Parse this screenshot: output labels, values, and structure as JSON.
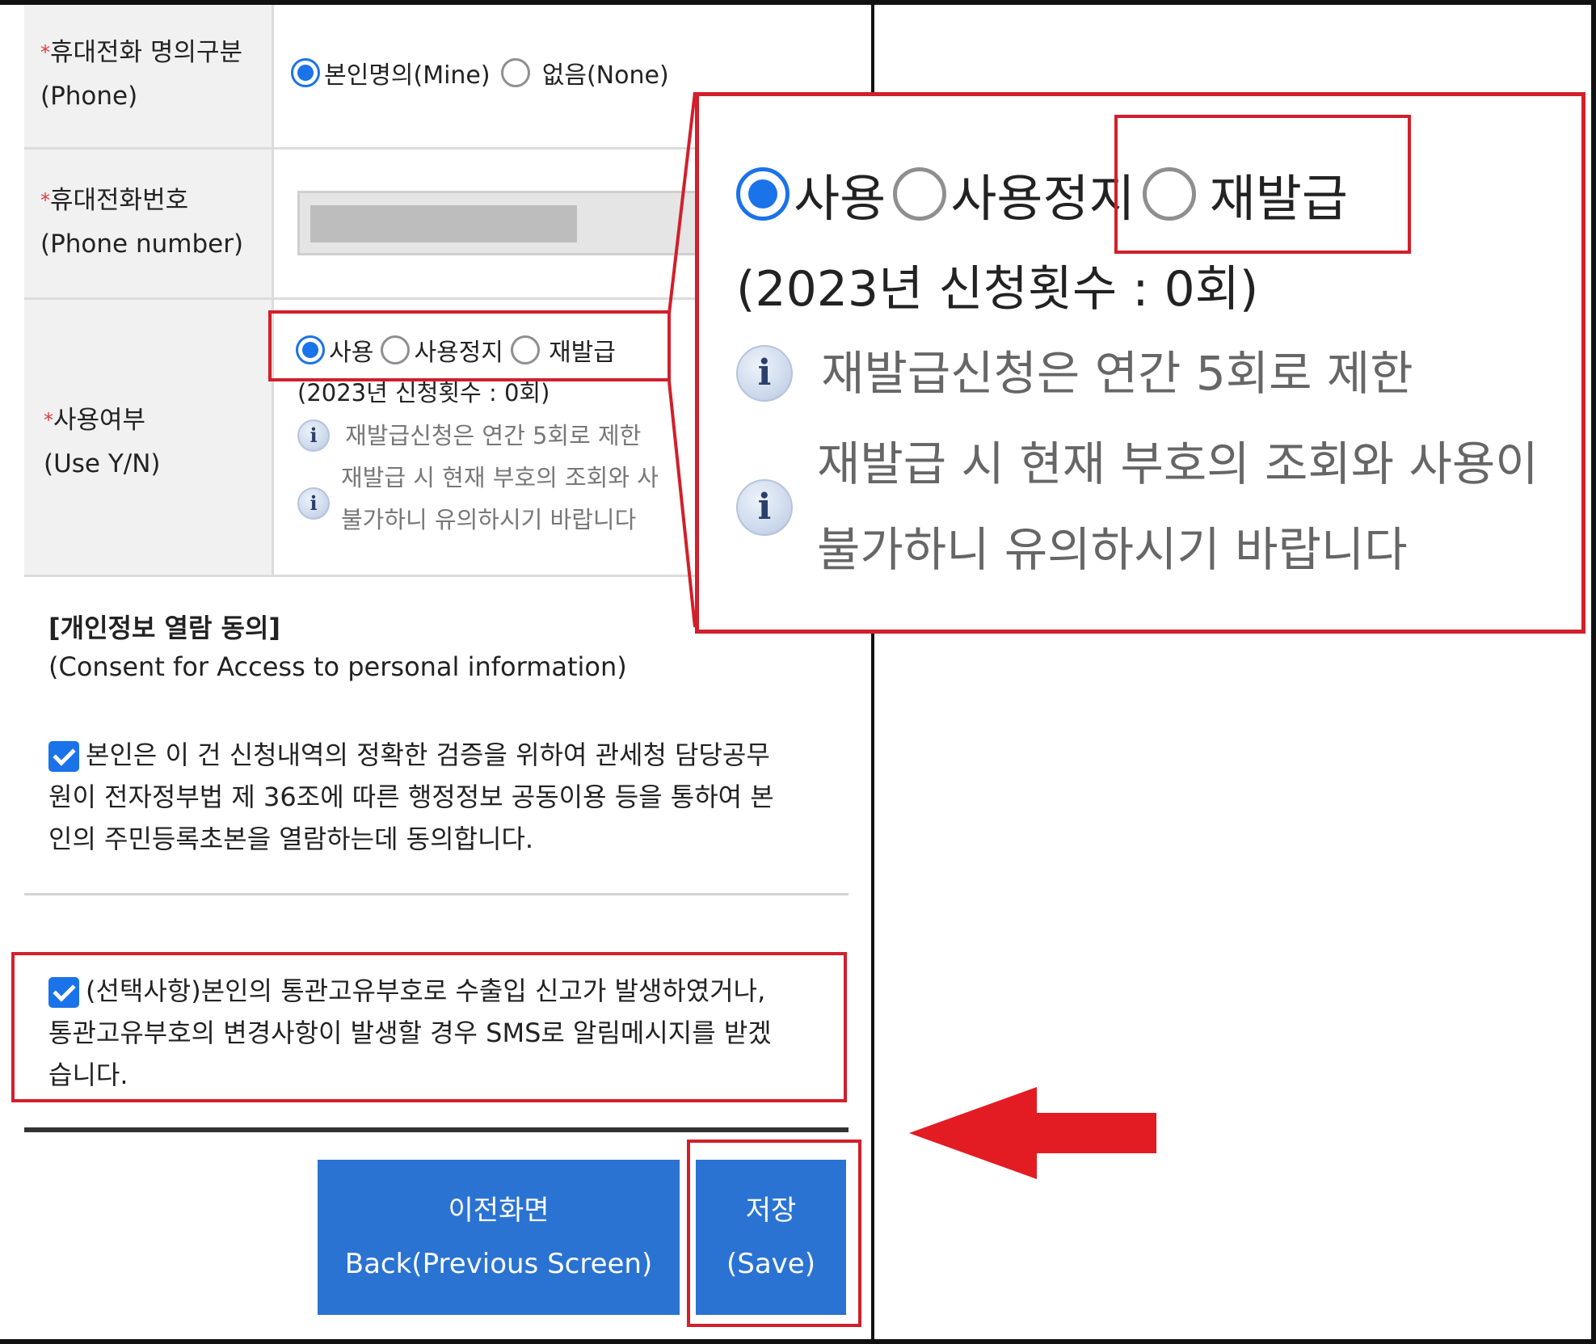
{
  "phone_owner": {
    "label_ko": "휴대전화 명의구분",
    "label_en": "(Phone)",
    "options": [
      {
        "label": "본인명의(Mine)",
        "checked": true
      },
      {
        "label": "없음(None)",
        "checked": false
      }
    ]
  },
  "phone_number": {
    "label_ko": "휴대전화번호",
    "label_en": "(Phone number)",
    "value": ""
  },
  "use_status": {
    "label_ko": "사용여부",
    "label_en": "(Use Y/N)",
    "options": [
      {
        "label": "사용",
        "checked": true
      },
      {
        "label": "사용정지",
        "checked": false
      },
      {
        "label": "재발급",
        "checked": false
      }
    ],
    "count_text": "(2023년 신청횟수 : 0회)",
    "note1": "재발급신청은 연간 5회로 제한",
    "note2_line1": "재발급 시 현재 부호의 조회와 사용이",
    "note2_line2": "불가하니 유의하시기 바랍니다",
    "note2_line1_cut": "재발급 시 현재 부호의 조회와 사",
    "note1_cut": "재발급신청은 연간 5회로 제한"
  },
  "required_mark": "*",
  "consent": {
    "title_ko": "[개인정보 열람 동의]",
    "title_en": "(Consent for Access to personal information)",
    "agree1_lines": [
      "본인은 이 건 신청내역의 정확한 검증을 위하여 관세청 담당공무",
      "원이 전자정부법 제 36조에 따른 행정정보 공동이용 등을 통하여 본",
      "인의 주민등록초본을 열람하는데 동의합니다."
    ],
    "agree2_lines": [
      "(선택사항)본인의 통관고유부호로 수출입 신고가 발생하였거나,",
      "통관고유부호의 변경사항이 발생할 경우 SMS로 알림메시지를 받겠",
      "습니다."
    ]
  },
  "buttons": {
    "back_ko": "이전화면",
    "back_en": "Back(Previous Screen)",
    "save_ko": "저장",
    "save_en": "(Save)"
  },
  "colors": {
    "accent": "#1a73e8",
    "button": "#2a73d2",
    "highlight": "#d21f2b"
  }
}
